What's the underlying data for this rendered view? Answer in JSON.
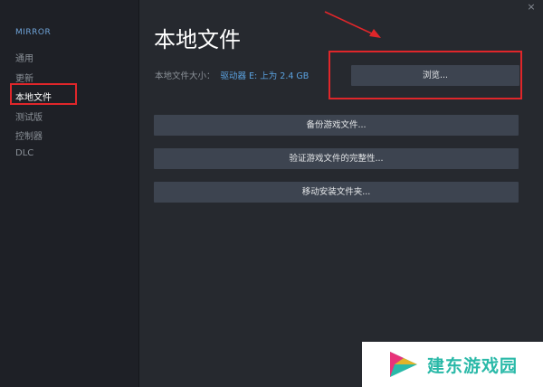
{
  "sidebar": {
    "title": "MIRROR",
    "items": [
      {
        "label": "通用",
        "active": false
      },
      {
        "label": "更新",
        "active": false
      },
      {
        "label": "本地文件",
        "active": true
      },
      {
        "label": "测试版",
        "active": false
      },
      {
        "label": "控制器",
        "active": false
      },
      {
        "label": "DLC",
        "active": false
      }
    ]
  },
  "main": {
    "title": "本地文件",
    "size_label": "本地文件大小：",
    "size_value": "驱动器 E: 上为 2.4 GB",
    "browse_label": "浏览...",
    "buttons": [
      {
        "label": "备份游戏文件..."
      },
      {
        "label": "验证游戏文件的完整性..."
      },
      {
        "label": "移动安装文件夹..."
      }
    ]
  },
  "window": {
    "close_glyph": "×"
  },
  "watermark": {
    "text": "建东游戏园"
  },
  "colors": {
    "accent": "#5ba2e0",
    "annotation": "#e0262a",
    "button": "#3d4450",
    "watermark_text": "#2ab9a8"
  }
}
